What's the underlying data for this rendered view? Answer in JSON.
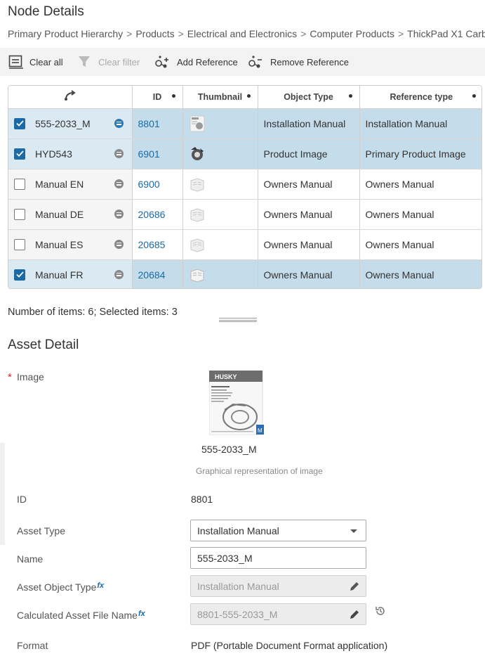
{
  "page_title": "Node Details",
  "breadcrumb": [
    "Primary Product Hierarchy",
    "Products",
    "Electrical and Electronics",
    "Computer Products",
    "ThickPad X1 Carb"
  ],
  "toolbar": {
    "clear_all": "Clear all",
    "clear_filter": "Clear filter",
    "add_reference": "Add Reference",
    "remove_reference": "Remove Reference"
  },
  "grid": {
    "columns": [
      "ID",
      "Thumbnail",
      "Object Type",
      "Reference type"
    ],
    "rows": [
      {
        "name": "555-2033_M",
        "id": "8801",
        "object_type": "Installation Manual",
        "reference_type": "Installation Manual",
        "selected": true
      },
      {
        "name": "HYD543",
        "id": "6901",
        "object_type": "Product Image",
        "reference_type": "Primary Product Image",
        "selected": true
      },
      {
        "name": "Manual EN",
        "id": "6900",
        "object_type": "Owners Manual",
        "reference_type": "Owners Manual",
        "selected": false
      },
      {
        "name": "Manual DE",
        "id": "20686",
        "object_type": "Owners Manual",
        "reference_type": "Owners Manual",
        "selected": false
      },
      {
        "name": "Manual ES",
        "id": "20685",
        "object_type": "Owners Manual",
        "reference_type": "Owners Manual",
        "selected": false
      },
      {
        "name": "Manual FR",
        "id": "20684",
        "object_type": "Owners Manual",
        "reference_type": "Owners Manual",
        "selected": true
      }
    ]
  },
  "count_text": "Number of items: 6; Selected items: 3",
  "asset_detail": {
    "title": "Asset Detail",
    "required_mark": "*",
    "image_label": "Image",
    "image_name": "555-2033_M",
    "image_caption": "Graphical representation of image",
    "image_brand": "HUSKY",
    "fx_mark": "fx",
    "id_label": "ID",
    "id_value": "8801",
    "asset_type_label": "Asset Type",
    "asset_type_value": "Installation Manual",
    "name_label": "Name",
    "name_value": "555-2033_M",
    "asset_object_type_label": "Asset Object Type",
    "asset_object_type_value": "Installation Manual",
    "calc_file_name_label": "Calculated Asset File Name",
    "calc_file_name_value": "8801-555-2033_M",
    "format_label": "Format",
    "format_value": "PDF (Portable Document Format application)"
  }
}
